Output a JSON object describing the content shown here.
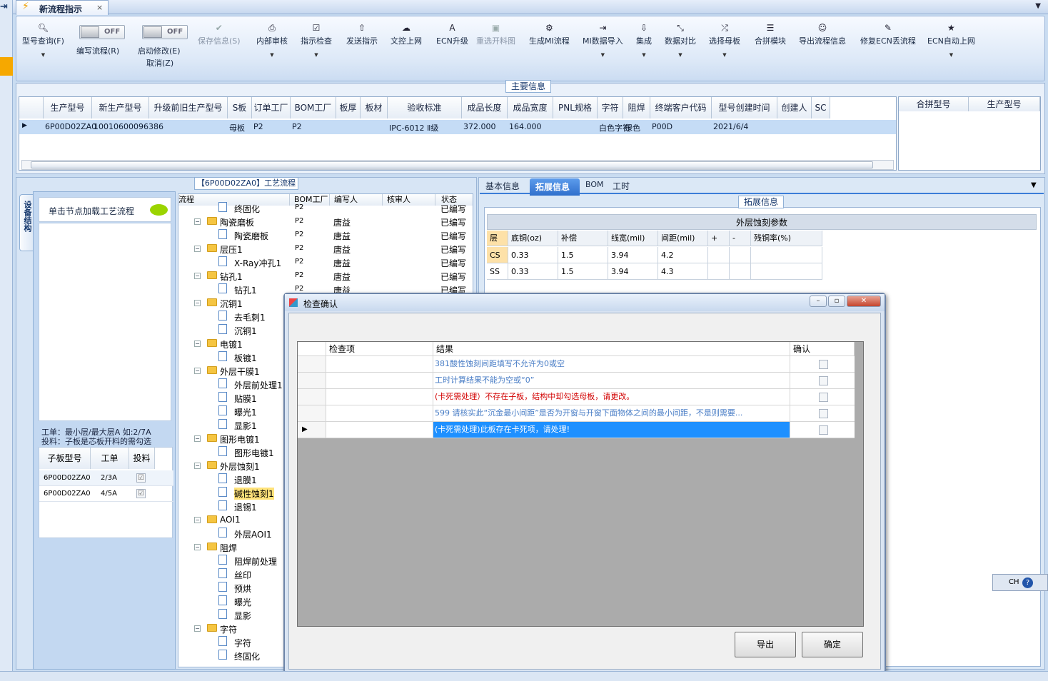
{
  "app": {
    "tab_title": "新流程指示",
    "close_glyph": "×",
    "menu_glyph": "▼"
  },
  "ribbon": {
    "query": {
      "label": "型号查询(F)",
      "icon": "search-icon"
    },
    "toggle_off": "OFF",
    "write_flow": "编写流程(R)",
    "start_modify": "启动修改(E)",
    "cancel": "取消(Z)",
    "save_info": "保存信息(S)",
    "buttons": [
      {
        "label": "内部审核",
        "icon": "printer-icon"
      },
      {
        "label": "指示检查",
        "icon": "checklist-icon"
      },
      {
        "label": "发送指示",
        "icon": "upload-icon"
      },
      {
        "label": "文控上网",
        "icon": "cloud-upload-icon"
      },
      {
        "label": "ECN升级",
        "icon": "letter-a-icon"
      },
      {
        "label": "重选开料图",
        "icon": "image-icon"
      },
      {
        "label": "生成MI流程",
        "icon": "gears-icon"
      },
      {
        "label": "MI数据导入",
        "icon": "import-icon"
      },
      {
        "label": "集成",
        "icon": "download-icon"
      },
      {
        "label": "数据对比",
        "icon": "compare-icon"
      },
      {
        "label": "选择母板",
        "icon": "shuffle-icon"
      },
      {
        "label": "合拼模块",
        "icon": "list-icon"
      },
      {
        "label": "导出流程信息",
        "icon": "smiley-icon"
      },
      {
        "label": "修复ECN丢流程",
        "icon": "wrench-icon"
      },
      {
        "label": "ECN自动上网",
        "icon": "star-icon"
      }
    ]
  },
  "main_info": {
    "title": "主要信息",
    "columns": [
      "生产型号",
      "新生产型号",
      "升级前旧生产型号",
      "S板",
      "订单工厂",
      "BOM工厂",
      "板厚",
      "板材",
      "验收标准",
      "成品长度",
      "成品宽度",
      "PNL规格",
      "字符",
      "阻焊",
      "终端客户代码",
      "型号创建时间",
      "创建人",
      "SC"
    ],
    "row": {
      "生产型号": "6P00D02ZA0",
      "新生产型号": "10010600096386",
      "S板": "母板",
      "订单工厂": "P2",
      "BOM工厂": "P2",
      "验收标准": "IPC-6012 Ⅱ级",
      "成品长度": "372.000",
      "成品宽度": "164.000",
      "字符": "白色字符",
      "阻焊": "绿色",
      "终端客户代码": "P00D",
      "型号创建时间": "2021/6/4"
    },
    "side_columns": [
      "合拼型号",
      "生产型号"
    ]
  },
  "process": {
    "title": "【6P00D02ZA0】工艺流程",
    "vtab": "设备结构",
    "hint": "单击节点加载工艺流程",
    "note1": "工单：最小层/最大层A 如:2/7A",
    "note2": "投料：子板是芯板开料的需勾选",
    "sub_columns": [
      "子板型号",
      "工单",
      "投料"
    ],
    "sub_rows": [
      {
        "model": "6P00D02ZA0",
        "order": "2/3A",
        "fed": "☑"
      },
      {
        "model": "6P00D02ZA0",
        "order": "4/5A",
        "fed": "☑"
      }
    ],
    "tree_columns": [
      "流程",
      "BOM工厂",
      "编写人",
      "核审人",
      "状态"
    ],
    "tree": [
      {
        "name": "终固化",
        "level": 2,
        "bom": "P2",
        "editor": "",
        "status": "已编写"
      },
      {
        "name": "陶瓷磨板",
        "level": 1,
        "bom": "P2",
        "editor": "唐益",
        "status": "已编写"
      },
      {
        "name": "陶瓷磨板",
        "level": 2,
        "bom": "P2",
        "editor": "唐益",
        "status": "已编写"
      },
      {
        "name": "层压1",
        "level": 1,
        "bom": "P2",
        "editor": "唐益",
        "status": "已编写"
      },
      {
        "name": "X-Ray冲孔1",
        "level": 2,
        "bom": "P2",
        "editor": "唐益",
        "status": "已编写"
      },
      {
        "name": "钻孔1",
        "level": 1,
        "bom": "P2",
        "editor": "唐益",
        "status": "已编写"
      },
      {
        "name": "钻孔1",
        "level": 2,
        "bom": "P2",
        "editor": "唐益",
        "status": "已编写"
      },
      {
        "name": "沉铜1",
        "level": 1,
        "bom": "",
        "editor": "",
        "status": ""
      },
      {
        "name": "去毛刺1",
        "level": 2,
        "bom": "",
        "editor": "",
        "status": ""
      },
      {
        "name": "沉铜1",
        "level": 2,
        "bom": "",
        "editor": "",
        "status": ""
      },
      {
        "name": "电镀1",
        "level": 1,
        "bom": "",
        "editor": "",
        "status": ""
      },
      {
        "name": "板镀1",
        "level": 2,
        "bom": "",
        "editor": "",
        "status": ""
      },
      {
        "name": "外层干膜1",
        "level": 1,
        "bom": "",
        "editor": "",
        "status": ""
      },
      {
        "name": "外层前处理1",
        "level": 2,
        "bom": "",
        "editor": "",
        "status": ""
      },
      {
        "name": "贴膜1",
        "level": 2,
        "bom": "",
        "editor": "",
        "status": ""
      },
      {
        "name": "曝光1",
        "level": 2,
        "bom": "",
        "editor": "",
        "status": ""
      },
      {
        "name": "显影1",
        "level": 2,
        "bom": "",
        "editor": "",
        "status": ""
      },
      {
        "name": "图形电镀1",
        "level": 1,
        "bom": "",
        "editor": "",
        "status": ""
      },
      {
        "name": "图形电镀1",
        "level": 2,
        "bom": "",
        "editor": "",
        "status": ""
      },
      {
        "name": "外层蚀刻1",
        "level": 1,
        "bom": "",
        "editor": "",
        "status": ""
      },
      {
        "name": "退膜1",
        "level": 2,
        "bom": "",
        "editor": "",
        "status": ""
      },
      {
        "name": "碱性蚀刻1",
        "level": 2,
        "bom": "",
        "editor": "",
        "status": "",
        "highlight": true
      },
      {
        "name": "退锡1",
        "level": 2,
        "bom": "",
        "editor": "",
        "status": ""
      },
      {
        "name": "AOI1",
        "level": 1,
        "bom": "",
        "editor": "",
        "status": ""
      },
      {
        "name": "外层AOI1",
        "level": 2,
        "bom": "",
        "editor": "",
        "status": ""
      },
      {
        "name": "阻焊",
        "level": 1,
        "bom": "",
        "editor": "",
        "status": ""
      },
      {
        "name": "阻焊前处理",
        "level": 2,
        "bom": "",
        "editor": "",
        "status": ""
      },
      {
        "name": "丝印",
        "level": 2,
        "bom": "",
        "editor": "",
        "status": ""
      },
      {
        "name": "预烘",
        "level": 2,
        "bom": "",
        "editor": "",
        "status": ""
      },
      {
        "name": "曝光",
        "level": 2,
        "bom": "",
        "editor": "",
        "status": ""
      },
      {
        "name": "显影",
        "level": 2,
        "bom": "",
        "editor": "",
        "status": ""
      },
      {
        "name": "字符",
        "level": 1,
        "bom": "",
        "editor": "",
        "status": ""
      },
      {
        "name": "字符",
        "level": 2,
        "bom": "",
        "editor": "",
        "status": ""
      },
      {
        "name": "终固化",
        "level": 2,
        "bom": "",
        "editor": "",
        "status": ""
      }
    ]
  },
  "right": {
    "tabs": [
      "基本信息",
      "拓展信息",
      "BOM",
      "工时"
    ],
    "ext_title": "拓展信息",
    "etch_title": "外层蚀刻参数",
    "etch_columns": [
      "层",
      "底铜(oz)",
      "补偿",
      "线宽(mil)",
      "间距(mil)",
      "+",
      "-",
      "残铜率(%)"
    ],
    "etch_rows": [
      [
        "CS",
        "0.33",
        "1.5",
        "3.94",
        "4.2",
        "",
        "",
        ""
      ],
      [
        "SS",
        "0.33",
        "1.5",
        "3.94",
        "4.3",
        "",
        "",
        ""
      ]
    ]
  },
  "dialog": {
    "title": "检查确认",
    "columns": [
      "检查项",
      "结果",
      "确认"
    ],
    "rows": [
      {
        "item": "",
        "result": "381酸性蚀刻间距填写不允许为0或空",
        "color": "blue"
      },
      {
        "item": "",
        "result": "工时计算结果不能为空或“0”",
        "color": "blue"
      },
      {
        "item": "",
        "result": "(卡死需处理）不存在子板，结构中却勾选母板，请更改。",
        "color": "red"
      },
      {
        "item": "",
        "result": "599 请核实此“沉金最小间距”是否为开窗与开窗下面物体之间的最小间距，不是则需要...",
        "color": "blue"
      },
      {
        "item": "",
        "result": "(卡死需处理)此板存在卡死项，请处理!",
        "color": "sel"
      }
    ],
    "export": "导出",
    "ok": "确定",
    "row_marker": "▶"
  },
  "ime": {
    "label": "CH",
    "help": "?"
  }
}
